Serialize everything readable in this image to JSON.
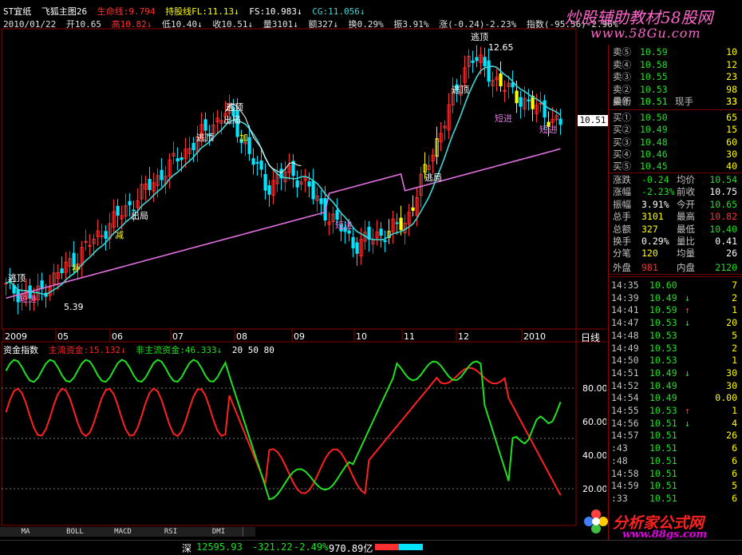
{
  "header": {
    "line1": {
      "stock_name": "ST宜纸",
      "indicator_name": "飞狐主图26",
      "life_line": "生命线:9.794",
      "hold_line": "持股线FL:11.13↓",
      "fs": "FS:10.983↓",
      "cg": "CG:11.056↓"
    },
    "line2": {
      "date": "2010/01/22",
      "open": "开10.65",
      "high": "高10.82↓",
      "low": "低10.40↓",
      "close": "收10.51↓",
      "volume": "量3101↓",
      "amount": "额327↓",
      "turnover": "换0.29%",
      "amplitude": "振3.91%",
      "change": "涨(-0.24)-2.23%",
      "index": "指数(-95.56)-2.96%"
    }
  },
  "watermark": {
    "top_title": "炒股辅助教材58股网",
    "top_url": "www.58Gu.com",
    "bottom_title": "分析家公式网",
    "bottom_url": "www.88gs.com"
  },
  "main_chart": {
    "annotations": [
      "逃顶",
      "出局",
      "逃顶",
      "短进",
      "出局",
      "逃顶",
      "12.65",
      "短进",
      "短进",
      "逃顶",
      "逃顶",
      "逃局",
      "短进",
      "加",
      "减",
      "补"
    ],
    "price_labels": {
      "high": "12.65",
      "low": "5.39",
      "current": "10.51"
    },
    "x_axis": [
      "2009",
      "05",
      "06",
      "07",
      "08",
      "09",
      "10",
      "11",
      "12",
      "2010"
    ],
    "period": "日线"
  },
  "sub_chart": {
    "title": "资金指数",
    "main_fund": "主流资金:15.132↓",
    "non_main_fund": "非主流资金:46.333↓",
    "levels": "20  50  80",
    "y_axis": [
      "80.00",
      "60.00",
      "40.00",
      "20.00"
    ]
  },
  "tabs": [
    "MA",
    "BOLL",
    "MACD",
    "RSI",
    "DMI"
  ],
  "quote_panel": {
    "sell": [
      {
        "label": "卖⑤",
        "price": "10.59",
        "vol": "10"
      },
      {
        "label": "卖④",
        "price": "10.58",
        "vol": "12"
      },
      {
        "label": "卖③",
        "price": "10.55",
        "vol": "23"
      },
      {
        "label": "卖②",
        "price": "10.53",
        "vol": "98"
      },
      {
        "label": "卖①",
        "price": "10.51",
        "vol": "33"
      }
    ],
    "latest": {
      "label": "最新",
      "price": "10.51",
      "tag": "现手",
      "vol": "33"
    },
    "buy": [
      {
        "label": "买①",
        "price": "10.50",
        "vol": "65"
      },
      {
        "label": "买②",
        "price": "10.49",
        "vol": "15"
      },
      {
        "label": "买③",
        "price": "10.48",
        "vol": "60"
      },
      {
        "label": "买④",
        "price": "10.46",
        "vol": "30"
      },
      {
        "label": "买⑤",
        "price": "10.45",
        "vol": "40"
      }
    ],
    "stats": [
      {
        "k1": "涨跌",
        "v1": "-0.24",
        "k2": "均价",
        "v2": "10.54"
      },
      {
        "k1": "涨幅",
        "v1": "-2.23%",
        "k2": "前收",
        "v2": "10.75"
      },
      {
        "k1": "振幅",
        "v1": "3.91%",
        "k2": "今开",
        "v2": "10.65"
      },
      {
        "k1": "总手",
        "v1": "3101",
        "k2": "最高",
        "v2": "10.82"
      },
      {
        "k1": "总额",
        "v1": "327",
        "k2": "最低",
        "v2": "10.40"
      },
      {
        "k1": "换手",
        "v1": "0.29%",
        "k2": "量比",
        "v2": "0.41"
      },
      {
        "k1": "分笔",
        "v1": "120",
        "k2": "均量",
        "v2": "26"
      },
      {
        "k1": "外盘",
        "v1": "981",
        "k2": "内盘",
        "v2": "2120"
      }
    ],
    "ticks": [
      {
        "t": "14:35",
        "p": "10.60",
        "a": "",
        "v": "7"
      },
      {
        "t": "14:39",
        "p": "10.49",
        "a": "↓",
        "v": "2"
      },
      {
        "t": "14:41",
        "p": "10.59",
        "a": "↑",
        "v": "1"
      },
      {
        "t": "14:47",
        "p": "10.53",
        "a": "↓",
        "v": "20"
      },
      {
        "t": "14:48",
        "p": "10.53",
        "a": "",
        "v": "5"
      },
      {
        "t": "14:49",
        "p": "10.53",
        "a": "",
        "v": "2"
      },
      {
        "t": "14:50",
        "p": "10.53",
        "a": "",
        "v": "1"
      },
      {
        "t": "14:51",
        "p": "10.49",
        "a": "↓",
        "v": "30"
      },
      {
        "t": "14:52",
        "p": "10.49",
        "a": "",
        "v": "30"
      },
      {
        "t": "14:54",
        "p": "10.49",
        "a": "",
        "v": "0.00"
      },
      {
        "t": "14:55",
        "p": "10.53",
        "a": "↑",
        "v": "1"
      },
      {
        "t": "14:56",
        "p": "10.51",
        "a": "↓",
        "v": "4"
      },
      {
        "t": "14:57",
        "p": "10.51",
        "a": "",
        "v": "26"
      },
      {
        "t": ":43",
        "p": "10.51",
        "a": "",
        "v": "6"
      },
      {
        "t": ":48",
        "p": "10.51",
        "a": "",
        "v": "6"
      },
      {
        "t": "14:58",
        "p": "10.51",
        "a": "",
        "v": "6"
      },
      {
        "t": "14:59",
        "p": "10.51",
        "a": "",
        "v": "5"
      },
      {
        "t": ":33",
        "p": "10.51",
        "a": "",
        "v": "6"
      }
    ]
  },
  "status_bar": {
    "index_name": "深",
    "index_value": "12595.93",
    "index_change": "-321.22",
    "index_pct": "-2.49%",
    "index_amount": "970.89亿"
  },
  "colors": {
    "up": "#ff3030",
    "down": "#00e5ff",
    "ma_life": "#3fd8d8",
    "ma_long": "#e070e0",
    "main_fund": "#ff2020",
    "non_main_fund": "#20e020",
    "accent": "#ffff00"
  }
}
